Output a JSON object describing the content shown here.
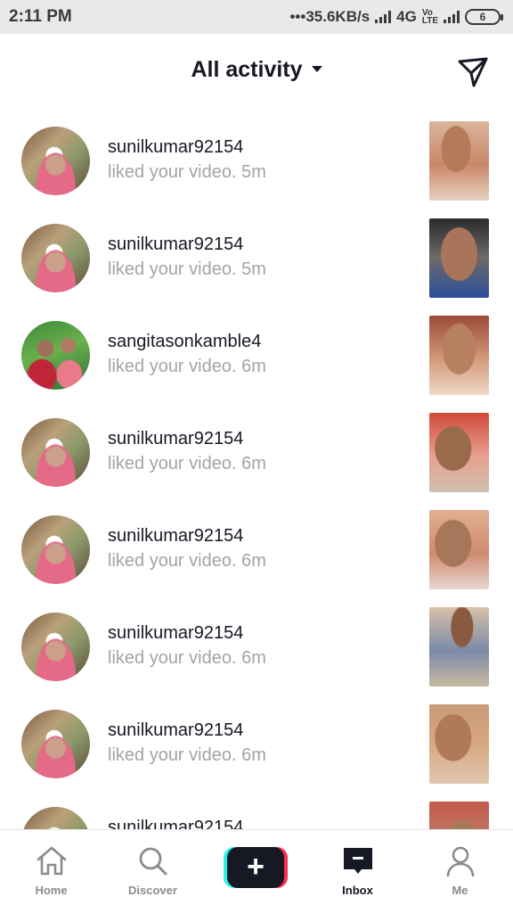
{
  "status_bar": {
    "time": "2:11 PM",
    "speed": "•••35.6KB/s",
    "network": "4G",
    "volte_top": "Vo",
    "volte_bottom": "LTE",
    "battery": "6"
  },
  "header": {
    "title": "All activity",
    "icons": {
      "dropdown": "caret-down-icon",
      "send": "send-icon"
    }
  },
  "activities": [
    {
      "username": "sunilkumar92154",
      "action": "liked your video. 5m"
    },
    {
      "username": "sunilkumar92154",
      "action": "liked your video. 5m"
    },
    {
      "username": "sangitasonkamble4",
      "action": "liked your video. 6m"
    },
    {
      "username": "sunilkumar92154",
      "action": "liked your video. 6m"
    },
    {
      "username": "sunilkumar92154",
      "action": "liked your video. 6m"
    },
    {
      "username": "sunilkumar92154",
      "action": "liked your video. 6m"
    },
    {
      "username": "sunilkumar92154",
      "action": "liked your video. 6m"
    },
    {
      "username": "sunilkumar92154",
      "action": ""
    }
  ],
  "nav": {
    "home": "Home",
    "discover": "Discover",
    "create": "+",
    "inbox": "Inbox",
    "me": "Me",
    "active": "inbox"
  },
  "colors": {
    "accent_red": "#fe2c55",
    "accent_cyan": "#25f4ee",
    "text_primary": "#161823",
    "text_secondary": "#a2a3a8"
  }
}
